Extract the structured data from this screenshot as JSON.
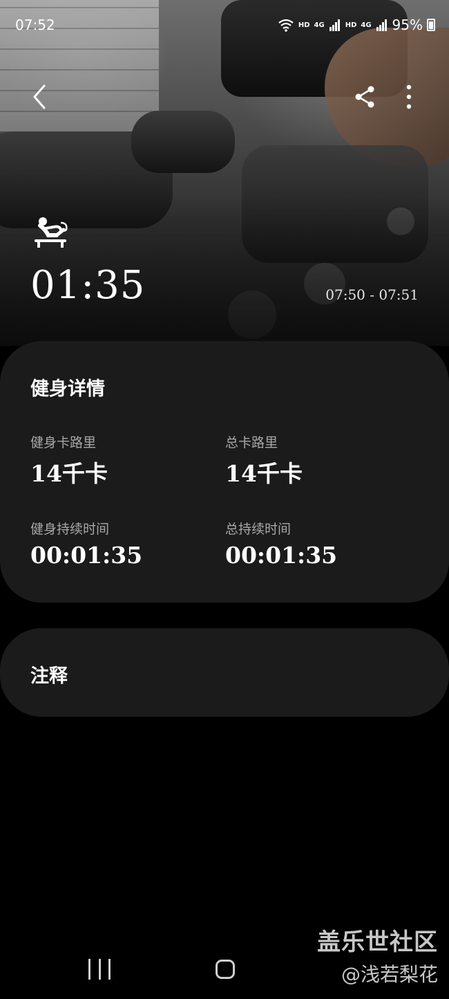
{
  "status_bar": {
    "time": "07:52",
    "network_label_1": "HD",
    "network_type_1": "4G",
    "network_label_2": "HD",
    "network_type_2": "4G",
    "battery": "95%"
  },
  "header": {
    "back_icon": "chevron-left-icon",
    "share_icon": "share-icon",
    "more_icon": "more-vertical-icon"
  },
  "workout": {
    "icon": "situp-workout-icon",
    "duration": "01:35",
    "time_range": "07:50 - 07:51"
  },
  "details_card": {
    "title": "健身详情",
    "stats": [
      {
        "label": "健身卡路里",
        "value": "14千卡"
      },
      {
        "label": "总卡路里",
        "value": "14千卡"
      },
      {
        "label": "健身持续时间",
        "value": "00:01:35"
      },
      {
        "label": "总持续时间",
        "value": "00:01:35"
      }
    ]
  },
  "notes_card": {
    "title": "注释"
  },
  "watermark": {
    "line1": "盖乐世社区",
    "line2": "@浅若梨花"
  }
}
